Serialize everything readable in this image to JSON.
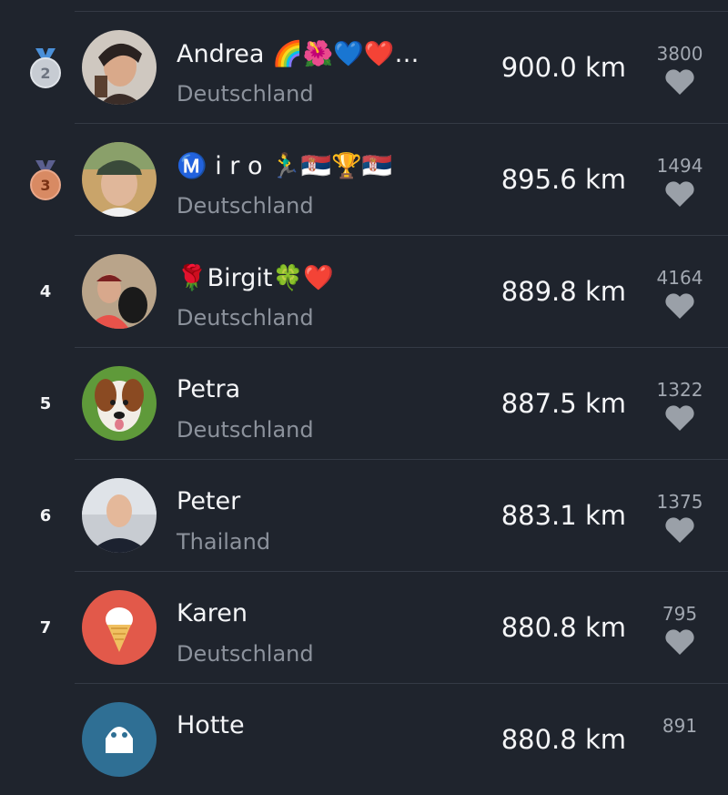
{
  "leaderboard": {
    "rows": [
      {
        "rank": "",
        "name": "",
        "country": "",
        "distance": "",
        "likes": ""
      },
      {
        "rank": "2",
        "name": "Andrea 🌈🌺💙❤️…",
        "country": "Deutschland",
        "distance": "900.0 km",
        "likes": "3800",
        "medal": "silver"
      },
      {
        "rank": "3",
        "name": "Ⓜ️ i r o 🏃‍♂️🇷🇸🏆🇷🇸",
        "country": "Deutschland",
        "distance": "895.6 km",
        "likes": "1494",
        "medal": "bronze"
      },
      {
        "rank": "4",
        "name": "🌹Birgit🍀❤️",
        "country": "Deutschland",
        "distance": "889.8 km",
        "likes": "4164"
      },
      {
        "rank": "5",
        "name": "Petra",
        "country": "Deutschland",
        "distance": "887.5 km",
        "likes": "1322"
      },
      {
        "rank": "6",
        "name": "Peter",
        "country": "Thailand",
        "distance": "883.1 km",
        "likes": "1375"
      },
      {
        "rank": "7",
        "name": "Karen",
        "country": "Deutschland",
        "distance": "880.8 km",
        "likes": "795"
      },
      {
        "rank": "",
        "name": "Hotte",
        "country": "",
        "distance": "880.8 km",
        "likes": "891"
      }
    ]
  },
  "colors": {
    "background": "#1f242d",
    "divider": "#343a45",
    "secondary_text": "#8c929c",
    "heart": "#9aa0a8"
  },
  "icons": {
    "like": "heart-icon",
    "silver_medal": "silver-medal-icon",
    "bronze_medal": "bronze-medal-icon"
  }
}
